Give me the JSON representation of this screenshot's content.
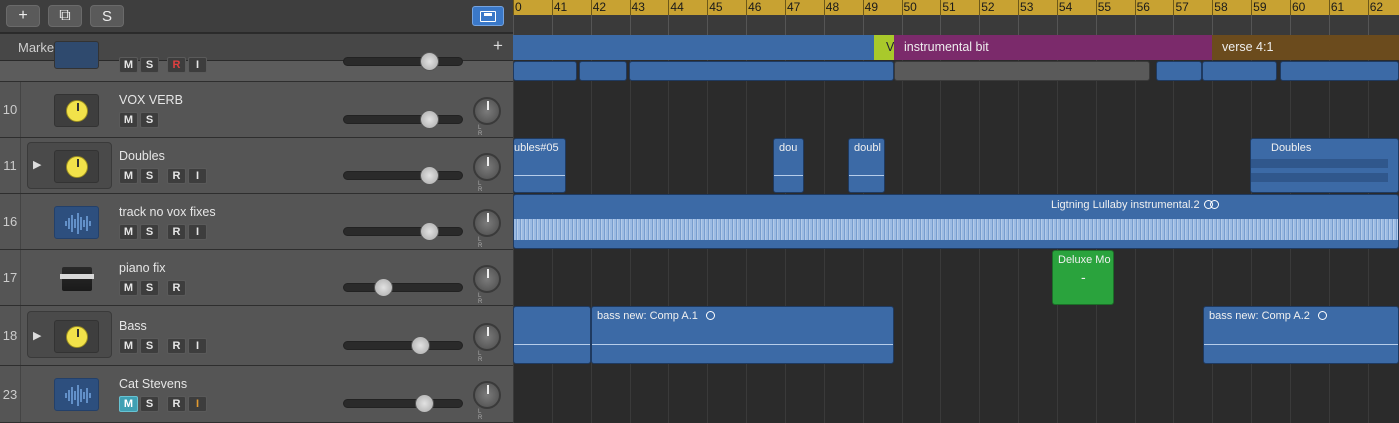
{
  "toolbar": {
    "add_track": "+",
    "duplicate_track": "⧉",
    "solo_label": "S"
  },
  "marker_row": {
    "label": "Marker",
    "add": "+"
  },
  "ruler": {
    "bars": [
      "0",
      "41",
      "42",
      "43",
      "44",
      "45",
      "46",
      "47",
      "48",
      "49",
      "50",
      "51",
      "52",
      "53",
      "54",
      "55",
      "56",
      "57",
      "58",
      "59",
      "60",
      "61",
      "62"
    ]
  },
  "markers": [
    {
      "label": "",
      "color": "#3c6aa6"
    },
    {
      "label": "V",
      "color": "#a9c92b"
    },
    {
      "label": "instrumental bit",
      "color": "#7b2a6b"
    },
    {
      "label": "verse 4:1",
      "color": "#6b4b1d"
    }
  ],
  "tracks": [
    {
      "num": "10",
      "name": "VOX VERB",
      "icon": "knob-icon",
      "buttons": [
        "M",
        "S"
      ]
    },
    {
      "num": "11",
      "name": "Doubles",
      "icon": "knob-icon",
      "buttons": [
        "M",
        "S",
        "R",
        "I"
      ]
    },
    {
      "num": "16",
      "name": "track no vox fixes",
      "icon": "waveform-icon",
      "buttons": [
        "M",
        "S",
        "R",
        "I"
      ]
    },
    {
      "num": "17",
      "name": "piano fix",
      "icon": "piano-icon",
      "buttons": [
        "M",
        "S",
        "R"
      ]
    },
    {
      "num": "18",
      "name": "Bass",
      "icon": "knob-icon",
      "buttons": [
        "M",
        "S",
        "R",
        "I"
      ]
    },
    {
      "num": "23",
      "name": "Cat Stevens",
      "icon": "waveform-icon",
      "buttons": [
        "M",
        "S",
        "R",
        "I"
      ]
    }
  ],
  "top_partial_track": {
    "buttons": [
      "M",
      "S",
      "R",
      "I"
    ]
  },
  "pan_labels": "L R",
  "regions": {
    "doubles_05": "ubles#05",
    "dou": "dou",
    "doubl": "doubl",
    "doubles": "Doubles",
    "lullaby": "Ligtning Lullaby instrumental.2",
    "deluxe": "Deluxe Mo",
    "deluxe_mark": "-",
    "bass_a1": "bass new: Comp A.1",
    "bass_a2": "bass new: Comp A.2"
  },
  "colors": {
    "ruler": "#c8a232",
    "region_blue": "#3c6aa6",
    "region_green": "#2aa33d",
    "monitor_active": "#3fa0b3",
    "record_red": "#e04040",
    "input_orange": "#e39b30"
  }
}
